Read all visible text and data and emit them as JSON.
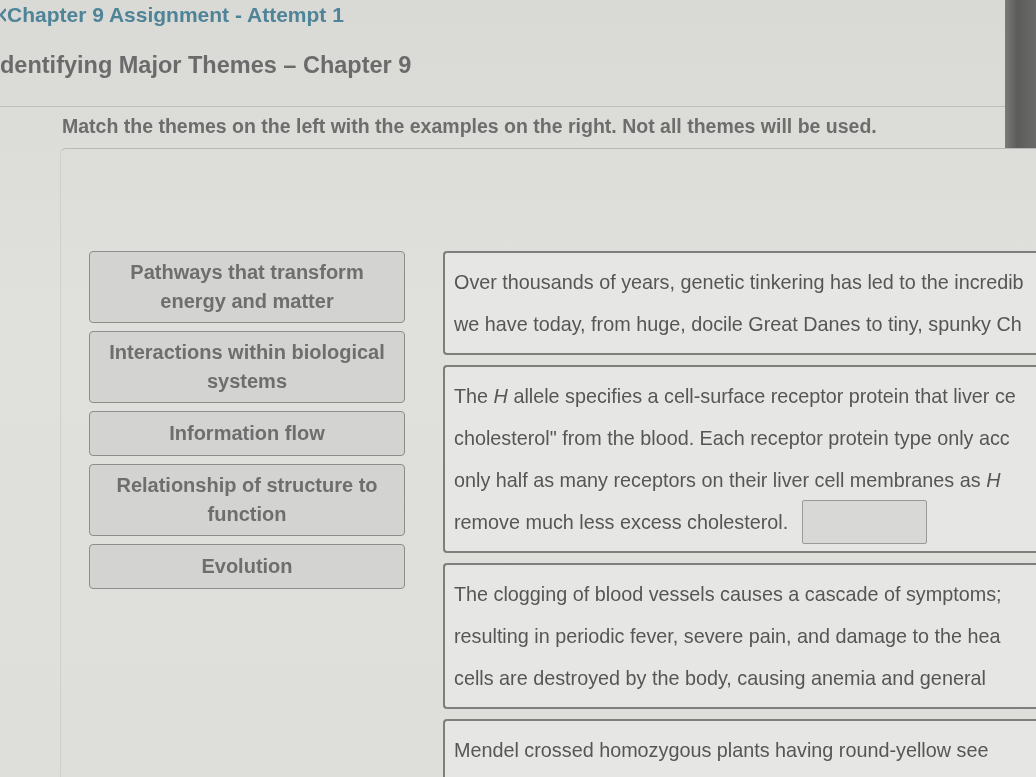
{
  "breadcrumb": {
    "label": "Chapter 9 Assignment - Attempt 1"
  },
  "heading": "dentifying Major Themes – Chapter 9",
  "instructions": "Match the themes on the left with the examples on the right. Not all themes will be used.",
  "themes": [
    {
      "label": "Pathways that transform energy and matter"
    },
    {
      "label": "Interactions within biological systems"
    },
    {
      "label": "Information flow"
    },
    {
      "label": "Relationship of structure to function"
    },
    {
      "label": "Evolution"
    }
  ],
  "examples": [
    {
      "lines": [
        "Over thousands of years, genetic tinkering has led to the incredib",
        "we have today, from huge, docile Great Danes to tiny, spunky Ch"
      ],
      "answer_box": false
    },
    {
      "lines": [
        "The *H* allele specifies a cell-surface receptor protein that liver ce",
        "cholesterol\" from the blood. Each receptor protein type only acc",
        "only half as many receptors on their liver cell membranes as *H*",
        "remove much less excess cholesterol."
      ],
      "answer_box": true
    },
    {
      "lines": [
        "The clogging of blood vessels causes a cascade of symptoms;",
        "resulting in periodic fever, severe pain, and damage to the hea",
        "cells are destroyed by the body, causing anemia and general"
      ],
      "answer_box": false
    },
    {
      "lines": [
        "Mendel crossed homozygous plants having round-yellow see"
      ],
      "answer_box": false
    }
  ]
}
